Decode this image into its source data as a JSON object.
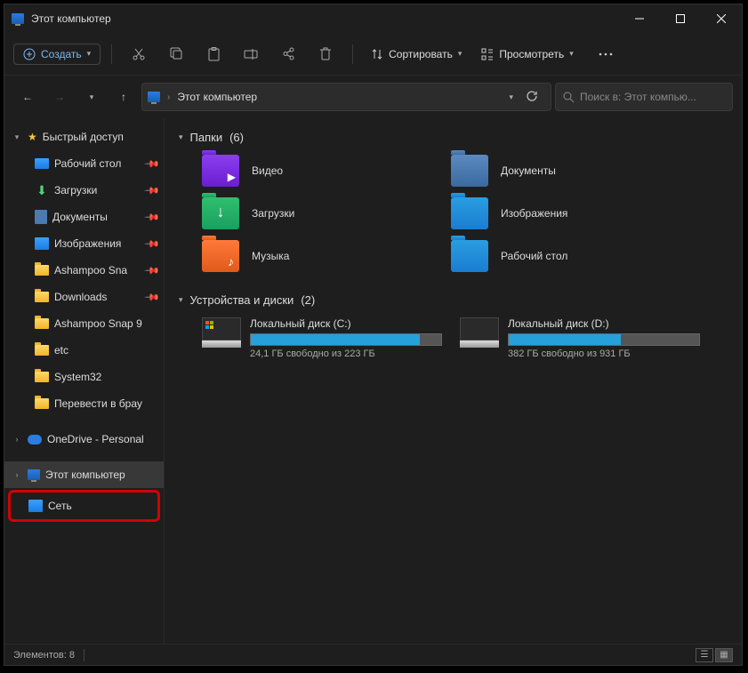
{
  "titlebar": {
    "title": "Этот компьютер"
  },
  "toolbar": {
    "new_label": "Создать",
    "sort_label": "Сортировать",
    "view_label": "Просмотреть"
  },
  "address": {
    "path_label": "Этот компьютер"
  },
  "search": {
    "placeholder": "Поиск в: Этот компью..."
  },
  "sidebar": {
    "quick_access": "Быстрый доступ",
    "items": [
      {
        "label": "Рабочий стол",
        "icon": "desktop",
        "pinned": true
      },
      {
        "label": "Загрузки",
        "icon": "download",
        "pinned": true
      },
      {
        "label": "Документы",
        "icon": "documents",
        "pinned": true
      },
      {
        "label": "Изображения",
        "icon": "pictures",
        "pinned": true
      },
      {
        "label": "Ashampoo Sna",
        "icon": "folder",
        "pinned": true
      },
      {
        "label": "Downloads",
        "icon": "folder",
        "pinned": true
      },
      {
        "label": "Ashampoo Snap 9",
        "icon": "folder",
        "pinned": false
      },
      {
        "label": "etc",
        "icon": "folder",
        "pinned": false
      },
      {
        "label": "System32",
        "icon": "folder",
        "pinned": false
      },
      {
        "label": "Перевести в брау",
        "icon": "folder",
        "pinned": false
      }
    ],
    "onedrive": "OneDrive - Personal",
    "this_pc": "Этот компьютер",
    "network": "Сеть"
  },
  "sections": {
    "folders": {
      "title": "Папки",
      "count": "(6)"
    },
    "drives": {
      "title": "Устройства и диски",
      "count": "(2)"
    }
  },
  "folders": [
    {
      "label": "Видео",
      "icon": "video"
    },
    {
      "label": "Документы",
      "icon": "docs"
    },
    {
      "label": "Загрузки",
      "icon": "dl"
    },
    {
      "label": "Изображения",
      "icon": "pics"
    },
    {
      "label": "Музыка",
      "icon": "music"
    },
    {
      "label": "Рабочий стол",
      "icon": "desktop"
    }
  ],
  "drives": [
    {
      "name": "Локальный диск (C:)",
      "free_text": "24,1 ГБ свободно из 223 ГБ",
      "fill_pct": 89,
      "windows": true
    },
    {
      "name": "Локальный диск (D:)",
      "free_text": "382 ГБ свободно из 931 ГБ",
      "fill_pct": 59,
      "windows": false
    }
  ],
  "statusbar": {
    "items_label": "Элементов:",
    "items_count": "8"
  }
}
